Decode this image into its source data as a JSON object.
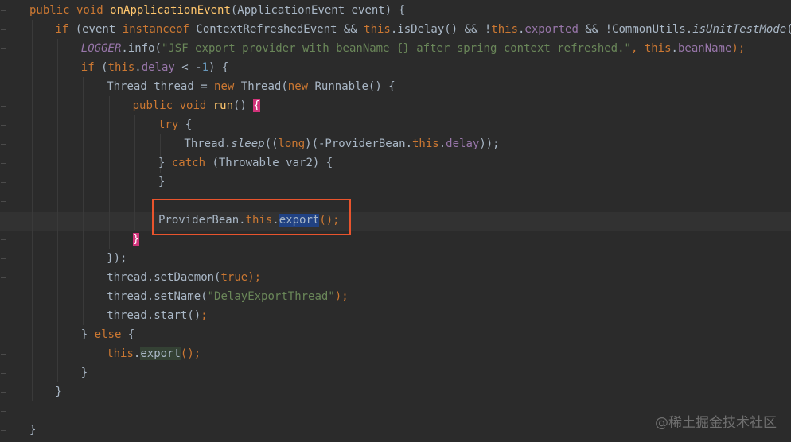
{
  "code_lines": [
    {
      "indent": 0,
      "tokens": [
        {
          "t": "public void ",
          "c": "kw"
        },
        {
          "t": "onApplicationEvent",
          "c": "fn"
        },
        {
          "t": "(ApplicationEvent event) {",
          "c": ""
        }
      ]
    },
    {
      "indent": 1,
      "tokens": [
        {
          "t": "if ",
          "c": "kw"
        },
        {
          "t": "(event ",
          "c": ""
        },
        {
          "t": "instanceof ",
          "c": "kw"
        },
        {
          "t": "ContextRefreshedEvent && ",
          "c": ""
        },
        {
          "t": "this",
          "c": "kw"
        },
        {
          "t": ".isDelay() && !",
          "c": ""
        },
        {
          "t": "this",
          "c": "kw"
        },
        {
          "t": ".",
          "c": ""
        },
        {
          "t": "exported",
          "c": "field"
        },
        {
          "t": " && !CommonUtils.",
          "c": ""
        },
        {
          "t": "isUnitTestMode",
          "c": "italic"
        },
        {
          "t": "()) {",
          "c": ""
        }
      ]
    },
    {
      "indent": 2,
      "tokens": [
        {
          "t": "LOGGER",
          "c": "static-field"
        },
        {
          "t": ".info(",
          "c": ""
        },
        {
          "t": "\"JSF export provider with beanName {} after spring context refreshed.\"",
          "c": "str"
        },
        {
          "t": ", ",
          "c": "kw"
        },
        {
          "t": "this",
          "c": "kw"
        },
        {
          "t": ".",
          "c": ""
        },
        {
          "t": "beanName",
          "c": "field"
        },
        {
          "t": ");",
          "c": "kw"
        }
      ]
    },
    {
      "indent": 2,
      "tokens": [
        {
          "t": "if ",
          "c": "kw"
        },
        {
          "t": "(",
          "c": ""
        },
        {
          "t": "this",
          "c": "kw"
        },
        {
          "t": ".",
          "c": ""
        },
        {
          "t": "delay",
          "c": "field"
        },
        {
          "t": " < -",
          "c": ""
        },
        {
          "t": "1",
          "c": "num"
        },
        {
          "t": ") {",
          "c": ""
        }
      ]
    },
    {
      "indent": 3,
      "tokens": [
        {
          "t": "Thread thread = ",
          "c": ""
        },
        {
          "t": "new ",
          "c": "kw"
        },
        {
          "t": "Thread(",
          "c": ""
        },
        {
          "t": "new ",
          "c": "kw"
        },
        {
          "t": "Runnable() {",
          "c": ""
        }
      ]
    },
    {
      "indent": 4,
      "tokens": [
        {
          "t": "public void ",
          "c": "kw"
        },
        {
          "t": "run",
          "c": "fn"
        },
        {
          "t": "() ",
          "c": ""
        },
        {
          "t": "{",
          "c": "brace-match"
        }
      ]
    },
    {
      "indent": 5,
      "tokens": [
        {
          "t": "try ",
          "c": "kw"
        },
        {
          "t": "{",
          "c": ""
        }
      ]
    },
    {
      "indent": 6,
      "tokens": [
        {
          "t": "Thread.",
          "c": ""
        },
        {
          "t": "sleep",
          "c": "italic"
        },
        {
          "t": "((",
          "c": ""
        },
        {
          "t": "long",
          "c": "kw"
        },
        {
          "t": ")(-ProviderBean.",
          "c": ""
        },
        {
          "t": "this",
          "c": "kw"
        },
        {
          "t": ".",
          "c": ""
        },
        {
          "t": "delay",
          "c": "field"
        },
        {
          "t": "));",
          "c": ""
        }
      ]
    },
    {
      "indent": 5,
      "tokens": [
        {
          "t": "} ",
          "c": ""
        },
        {
          "t": "catch ",
          "c": "kw"
        },
        {
          "t": "(Throwable var2) {",
          "c": ""
        }
      ]
    },
    {
      "indent": 5,
      "tokens": [
        {
          "t": "}",
          "c": ""
        }
      ]
    },
    {
      "indent": 0,
      "tokens": []
    },
    {
      "indent": 5,
      "tokens": [
        {
          "t": "ProviderBean.",
          "c": ""
        },
        {
          "t": "this",
          "c": "kw"
        },
        {
          "t": ".",
          "c": ""
        },
        {
          "t": "export",
          "c": "sel"
        },
        {
          "t": "();",
          "c": "kw"
        }
      ]
    },
    {
      "indent": 4,
      "tokens": [
        {
          "t": "}",
          "c": "brace-match"
        }
      ]
    },
    {
      "indent": 3,
      "tokens": [
        {
          "t": "});",
          "c": ""
        }
      ]
    },
    {
      "indent": 3,
      "tokens": [
        {
          "t": "thread.setDaemon(",
          "c": ""
        },
        {
          "t": "true",
          "c": "kw"
        },
        {
          "t": ");",
          "c": "kw"
        }
      ]
    },
    {
      "indent": 3,
      "tokens": [
        {
          "t": "thread.setName(",
          "c": ""
        },
        {
          "t": "\"DelayExportThread\"",
          "c": "str"
        },
        {
          "t": ");",
          "c": "kw"
        }
      ]
    },
    {
      "indent": 3,
      "tokens": [
        {
          "t": "thread.start()",
          "c": ""
        },
        {
          "t": ";",
          "c": "kw"
        }
      ]
    },
    {
      "indent": 2,
      "tokens": [
        {
          "t": "} ",
          "c": ""
        },
        {
          "t": "else ",
          "c": "kw"
        },
        {
          "t": "{",
          "c": ""
        }
      ]
    },
    {
      "indent": 3,
      "tokens": [
        {
          "t": "this",
          "c": "kw"
        },
        {
          "t": ".",
          "c": ""
        },
        {
          "t": "export",
          "c": "usage"
        },
        {
          "t": "();",
          "c": "kw"
        }
      ]
    },
    {
      "indent": 2,
      "tokens": [
        {
          "t": "}",
          "c": ""
        }
      ]
    },
    {
      "indent": 1,
      "tokens": [
        {
          "t": "}",
          "c": ""
        }
      ]
    },
    {
      "indent": 0,
      "tokens": []
    },
    {
      "indent": 0,
      "tokens": [
        {
          "t": "}",
          "c": ""
        }
      ]
    }
  ],
  "watermark": "@稀土掘金技术社区"
}
